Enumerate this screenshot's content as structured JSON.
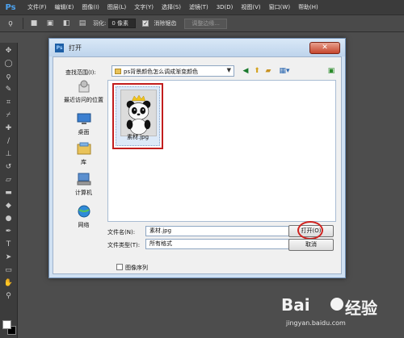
{
  "app": {
    "logo": "Ps",
    "menu": [
      "文件(F)",
      "编辑(E)",
      "图像(I)",
      "图层(L)",
      "文字(Y)",
      "选择(S)",
      "滤镜(T)",
      "3D(D)",
      "视图(V)",
      "窗口(W)",
      "帮助(H)"
    ]
  },
  "options_bar": {
    "feather_label": "羽化:",
    "feather_value": "0 像素",
    "antialias_label": "消除锯齿",
    "refine_edge_label": "调整边缘..."
  },
  "dialog": {
    "title": "打开",
    "close_glyph": "✕",
    "look_in_label": "查找范围(I):",
    "look_in_value": "ps背景颜色怎么调成渐变颜色",
    "places": [
      "最近访问的位置",
      "桌面",
      "库",
      "计算机",
      "网络"
    ],
    "files": [
      {
        "name": "素材.jpg"
      }
    ],
    "file_name_label": "文件名(N):",
    "file_name_value": "素材.jpg",
    "file_type_label": "文件类型(T):",
    "file_type_value": "所有格式",
    "open_button": "打开(O)",
    "cancel_button": "取消",
    "image_sequence_label": "图像序列"
  },
  "watermark": {
    "logo_left": "Bai",
    "logo_right": "经验",
    "url": "jingyan.baidu.com"
  }
}
